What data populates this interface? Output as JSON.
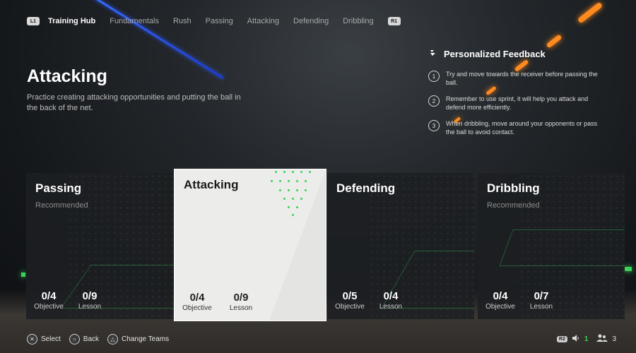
{
  "nav": {
    "left_tag": "L1",
    "right_tag": "R1",
    "items": [
      {
        "label": "Training Hub",
        "active": true
      },
      {
        "label": "Fundamentals",
        "active": false
      },
      {
        "label": "Rush",
        "active": false
      },
      {
        "label": "Passing",
        "active": false
      },
      {
        "label": "Attacking",
        "active": false
      },
      {
        "label": "Defending",
        "active": false
      },
      {
        "label": "Dribbling",
        "active": false
      }
    ]
  },
  "hero": {
    "title": "Attacking",
    "description": "Practice creating attacking opportunities and putting the ball in the back of the net."
  },
  "feedback": {
    "title": "Personalized Feedback",
    "items": [
      {
        "num": "1",
        "text": "Try and move towards the receiver before passing the ball."
      },
      {
        "num": "2",
        "text": "Remember to use sprint, it will help you attack and defend more efficiently."
      },
      {
        "num": "3",
        "text": "When dribbling, move around your opponents or pass the ball to avoid contact."
      }
    ]
  },
  "cards": [
    {
      "title": "Passing",
      "subtitle": "Recommended",
      "objective": "0/4",
      "lesson": "0/9",
      "objective_label": "Objective",
      "lesson_label": "Lesson"
    },
    {
      "title": "Attacking",
      "subtitle": "",
      "objective": "0/4",
      "lesson": "0/9",
      "objective_label": "Objective",
      "lesson_label": "Lesson"
    },
    {
      "title": "Defending",
      "subtitle": "",
      "objective": "0/5",
      "lesson": "0/4",
      "objective_label": "Objective",
      "lesson_label": "Lesson"
    },
    {
      "title": "Dribbling",
      "subtitle": "Recommended",
      "objective": "0/4",
      "lesson": "0/7",
      "objective_label": "Objective",
      "lesson_label": "Lesson"
    }
  ],
  "bottom": {
    "select": "Select",
    "back": "Back",
    "change_teams": "Change Teams",
    "r2_tag": "R2",
    "count_green": "1",
    "count_players": "3"
  },
  "icons": {
    "select": "cross-button-icon",
    "back": "circle-button-icon",
    "change_teams": "triangle-button-icon",
    "feedback": "feedback-logo-icon",
    "speaker": "speaker-icon",
    "players": "players-icon"
  },
  "colors": {
    "accent_green": "#3bd35a",
    "accent_orange": "#ff8a1f",
    "selected_card": "#ececea"
  }
}
